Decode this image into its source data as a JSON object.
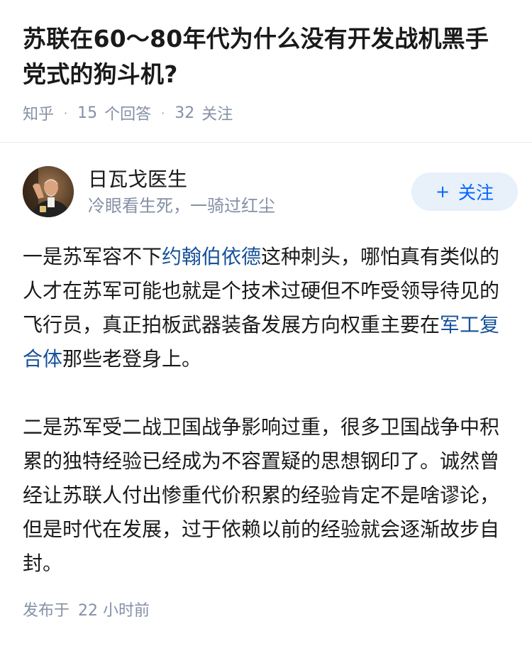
{
  "question": {
    "title": "苏联在60～80年代为什么没有开发战机黑手党式的狗斗机?",
    "source": "知乎",
    "answer_count": "15",
    "answer_label": "个回答",
    "follow_count": "32",
    "follow_label": "关注"
  },
  "author": {
    "name": "日瓦戈医生",
    "bio": "冷眼看生死，一骑过红尘",
    "follow_button": "关注",
    "follow_icon": "plus-icon"
  },
  "answer": {
    "p1_a": "一是苏军容不下",
    "p1_link1": "约翰伯依德",
    "p1_b": "这种刺头，哪怕真有类似的人才在苏军可能也就是个技术过硬但不咋受领导待见的飞行员，真正拍板武器装备发展方向权重主要在",
    "p1_link2": "军工复合体",
    "p1_c": "那些老登身上。",
    "p2": "二是苏军受二战卫国战争影响过重，很多卫国战争中积累的独特经验已经成为不容置疑的思想钢印了。诚然曾经让苏联人付出惨重代价积累的经验肯定不是啥谬论，但是时代在发展，过于依赖以前的经验就会逐渐故步自封。"
  },
  "footer": {
    "published_label": "发布于",
    "published_time": "22 小时前"
  },
  "colors": {
    "link": "#175199",
    "accent": "#0066ff",
    "meta": "#8590a6",
    "follow_bg": "#e8f0fa"
  }
}
